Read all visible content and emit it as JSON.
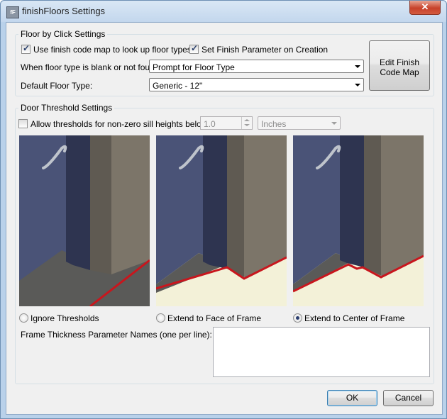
{
  "window": {
    "title": "finishFloors Settings",
    "icon_label": "fF",
    "close_glyph": "✕"
  },
  "floor_group": {
    "title": "Floor by Click Settings",
    "use_map": {
      "label": "Use finish code map to look up floor types",
      "checked": true
    },
    "set_finish": {
      "label": "Set Finish Parameter on Creation",
      "checked": true
    },
    "blank_label": "When floor type is blank or not found:",
    "blank_value": "Prompt for Floor Type",
    "default_label": "Default Floor Type:",
    "default_value": "Generic - 12\"",
    "edit_button_line1": "Edit Finish",
    "edit_button_line2": "Code Map"
  },
  "threshold_group": {
    "title": "Door Threshold Settings",
    "allow": {
      "label": "Allow thresholds for non-zero sill heights below:",
      "checked": false
    },
    "height_value": "1.0",
    "units_value": "Inches",
    "options": [
      {
        "label": "Ignore Thresholds",
        "selected": false
      },
      {
        "label": "Extend to Face of Frame",
        "selected": false
      },
      {
        "label": "Extend to Center of Frame",
        "selected": true
      }
    ],
    "frame_label": "Frame Thickness Parameter Names (one per line):",
    "frame_value": ""
  },
  "buttons": {
    "ok": "OK",
    "cancel": "Cancel"
  },
  "colors": {
    "wall": "#4a5377",
    "frame": "#2e3450",
    "door": "#7c7569",
    "floor_dark": "#5a5a58",
    "floor_light": "#f3f1d8",
    "threshold_line": "#c8161d"
  }
}
